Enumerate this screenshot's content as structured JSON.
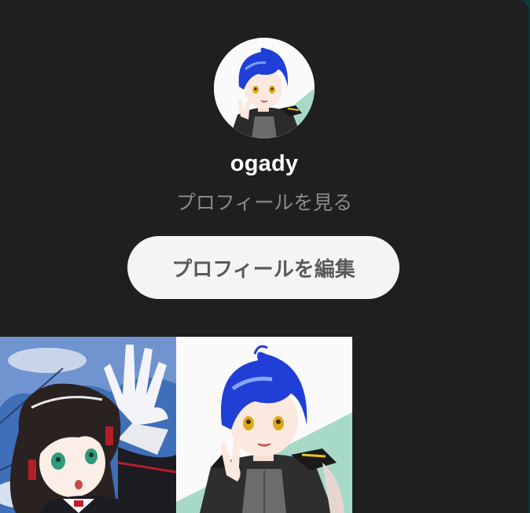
{
  "profile": {
    "username": "ogady",
    "view_profile_link": "プロフィールを見る",
    "edit_button": "プロフィールを編集"
  },
  "thumbnails": [
    {
      "subject": "girl-sky-illustration"
    },
    {
      "subject": "blue-hair-character-illustration"
    }
  ],
  "colors": {
    "panel_bg": "#1f1f1f",
    "button_bg": "#f4f4f4",
    "button_text": "#5a5a5a",
    "username": "#ffffff",
    "subtext": "#8a8a8a",
    "hair_blue": "#1f3fd6",
    "teal_accent": "#a6d9c8"
  }
}
